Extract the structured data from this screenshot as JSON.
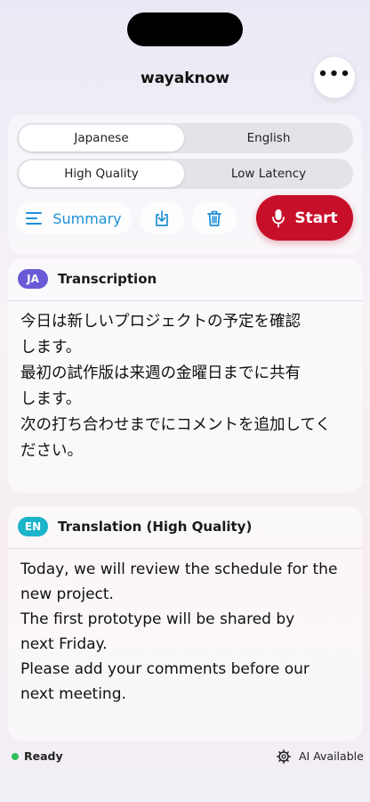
{
  "app": {
    "title": "wayaknow"
  },
  "header": {
    "more_icon": "ellipsis-icon",
    "more_label": "•••"
  },
  "language_toggle": {
    "options": [
      "Japanese",
      "English"
    ],
    "selected": "Japanese"
  },
  "quality_toggle": {
    "options": [
      "High Quality",
      "Low Latency"
    ],
    "selected": "High Quality"
  },
  "actions": {
    "summary_label": "Summary",
    "summary_icon": "list-icon",
    "save_icon": "download-icon",
    "delete_icon": "trash-icon",
    "start_label": "Start",
    "start_icon": "microphone-icon"
  },
  "transcription": {
    "badge": "JA",
    "badge_color": "#6a5ad8",
    "title": "Transcription",
    "lines": [
      "今日は新しいプロジェクトの予定を確認\nします。",
      "最初の試作版は来週の金曜日までに共有\nします。",
      "次の打ち合わせまでにコメントを追加してく\nださい。"
    ]
  },
  "translation": {
    "badge": "EN",
    "badge_color": "#1bb4c9",
    "title": "Translation (High Quality)",
    "lines": [
      "Today, we will review the schedule for the\nnew project.",
      "The first prototype will be shared by\nnext Friday.",
      "Please add your comments before our\nnext meeting."
    ]
  },
  "status": {
    "state": "Ready",
    "state_color": "#2ec05a",
    "ai_icon": "gear-icon",
    "ai_label": "AI Available"
  },
  "colors": {
    "accent": "#1e8fd6",
    "start": "#c80f2a"
  }
}
